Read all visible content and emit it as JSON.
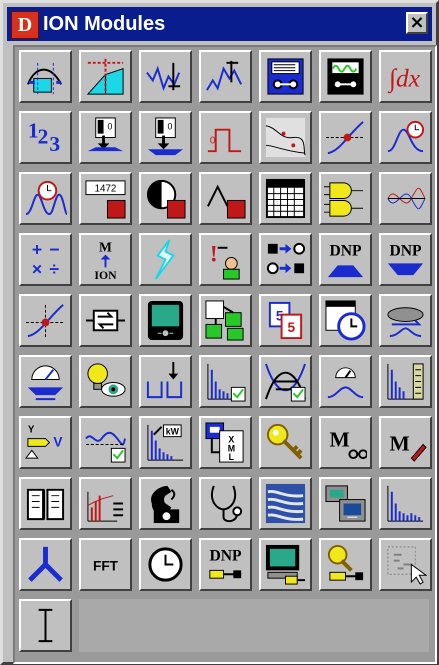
{
  "window": {
    "title": "ION Modules",
    "icon_letter": "D",
    "close_label": "×"
  },
  "colors": {
    "titlebar": "#0a1d8f",
    "face": "#c0c0c0",
    "blue": "#1a2bd0",
    "red": "#c01818",
    "cyan": "#1ad8e8",
    "green": "#28c828",
    "yellow": "#f0e81a"
  },
  "modules": [
    [
      {
        "name": "scaled-histogram-module-icon"
      },
      {
        "name": "integrator-area-module-icon"
      },
      {
        "name": "minimum-module-icon"
      },
      {
        "name": "maximum-module-icon"
      },
      {
        "name": "data-recorder-module-icon"
      },
      {
        "name": "waveform-recorder-module-icon"
      },
      {
        "name": "integral-module-icon",
        "text": "∫dx"
      }
    ],
    [
      {
        "name": "counter-module-icon",
        "text": "123"
      },
      {
        "name": "external-pulse-module-icon"
      },
      {
        "name": "external-boolean-module-icon"
      },
      {
        "name": "pulser-module-icon"
      },
      {
        "name": "sag-swell-module-icon"
      },
      {
        "name": "setpoint-module-icon"
      },
      {
        "name": "periodic-timer-module-icon"
      }
    ],
    [
      {
        "name": "one-shot-timer-module-icon"
      },
      {
        "name": "display-module-icon",
        "text": "1472"
      },
      {
        "name": "digital-output-module-icon"
      },
      {
        "name": "pulse-output-module-icon"
      },
      {
        "name": "calendar-module-icon"
      },
      {
        "name": "logic-gates-module-icon"
      },
      {
        "name": "harmonics-analyzer-module-icon"
      }
    ],
    [
      {
        "name": "arithmetic-module-icon",
        "text": "+−×÷"
      },
      {
        "name": "mion-module-icon",
        "text": "M ION"
      },
      {
        "name": "transient-module-icon"
      },
      {
        "name": "alert-module-icon"
      },
      {
        "name": "convert-module-icon"
      },
      {
        "name": "dnp-slave-export-module-icon",
        "text": "DNP"
      },
      {
        "name": "dnp-slave-import-module-icon",
        "text": "DNP"
      }
    ],
    [
      {
        "name": "relative-setpoint-module-icon"
      },
      {
        "name": "feedback-module-icon"
      },
      {
        "name": "communications-module-icon"
      },
      {
        "name": "scheduler-module-icon"
      },
      {
        "name": "copy-module-icon",
        "text": "55"
      },
      {
        "name": "clock-module-icon"
      },
      {
        "name": "disk-simulator-module-icon"
      }
    ],
    [
      {
        "name": "analog-input-module-icon"
      },
      {
        "name": "light-watch-module-icon"
      },
      {
        "name": "store-module-icon"
      },
      {
        "name": "harmonic-measurement-module-icon"
      },
      {
        "name": "symmetrical-components-module-icon"
      },
      {
        "name": "power-meter-module-icon"
      },
      {
        "name": "bar-graph-module-icon"
      }
    ],
    [
      {
        "name": "sliding-window-demand-module-icon",
        "text": "Y V"
      },
      {
        "name": "thermal-demand-module-icon"
      },
      {
        "name": "kw-demand-module-icon",
        "text": "kW"
      },
      {
        "name": "xml-report-module-icon",
        "text": "XML"
      },
      {
        "name": "security-key-module-icon"
      },
      {
        "name": "meter-view-module-icon",
        "text": "M"
      },
      {
        "name": "meter-edit-module-icon",
        "text": "M"
      }
    ],
    [
      {
        "name": "event-log-module-icon"
      },
      {
        "name": "trend-module-icon"
      },
      {
        "name": "dial-out-module-icon"
      },
      {
        "name": "diagnostics-module-icon"
      },
      {
        "name": "waveform-compression-module-icon"
      },
      {
        "name": "network-view-module-icon"
      },
      {
        "name": "interval-bars-module-icon"
      }
    ],
    [
      {
        "name": "three-phase-module-icon"
      },
      {
        "name": "fft-module-icon",
        "text": "FFT"
      },
      {
        "name": "timer-clock-module-icon"
      },
      {
        "name": "dnp-options-module-icon",
        "text": "DNP"
      },
      {
        "name": "computer-connection-module-icon"
      },
      {
        "name": "key-connection-module-icon"
      },
      {
        "name": "grid-select-module-icon"
      }
    ],
    [
      {
        "name": "text-cursor-module-icon",
        "text": "I"
      }
    ]
  ]
}
